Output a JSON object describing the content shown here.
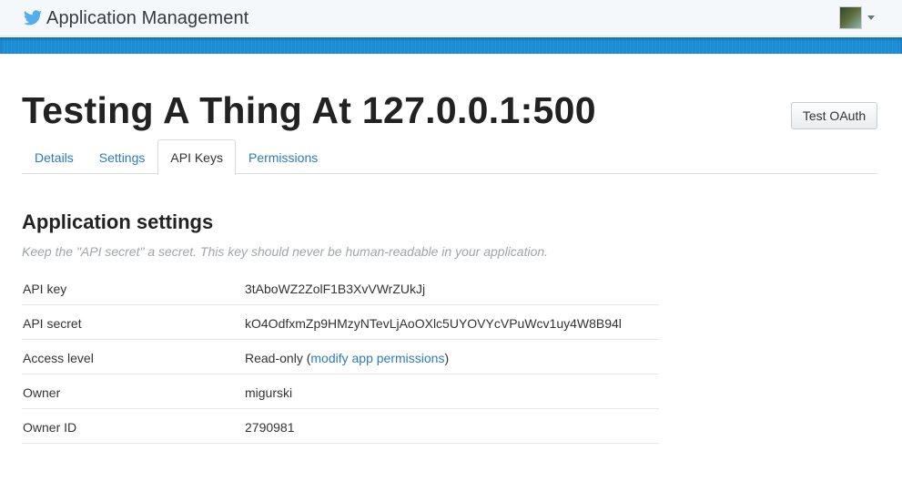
{
  "header": {
    "brand_title": "Application Management",
    "brand_icon": "twitter-bird-icon",
    "brand_color": "#55acee",
    "stripe_color": "#1b8dd6"
  },
  "app": {
    "title": "Testing A Thing At 127.0.0.1:500",
    "test_oauth_label": "Test OAuth"
  },
  "tabs": [
    {
      "label": "Details",
      "active": false
    },
    {
      "label": "Settings",
      "active": false
    },
    {
      "label": "API Keys",
      "active": true
    },
    {
      "label": "Permissions",
      "active": false
    }
  ],
  "settings": {
    "heading": "Application settings",
    "hint": "Keep the \"API secret\" a secret. This key should never be human-readable in your application.",
    "rows": {
      "api_key": {
        "label": "API key",
        "value": "3tAboWZ2ZolF1B3XvVWrZUkJj"
      },
      "api_secret": {
        "label": "API secret",
        "value": "kO4OdfxmZp9HMzyNTevLjAoOXlc5UYOVYcVPuWcv1uy4W8B94l"
      },
      "access_level": {
        "label": "Access level",
        "value": "Read-only",
        "open_paren": " (",
        "link_text": "modify app permissions",
        "close_paren": ")"
      },
      "owner": {
        "label": "Owner",
        "value": "migurski"
      },
      "owner_id": {
        "label": "Owner ID",
        "value": "2790981"
      }
    }
  }
}
